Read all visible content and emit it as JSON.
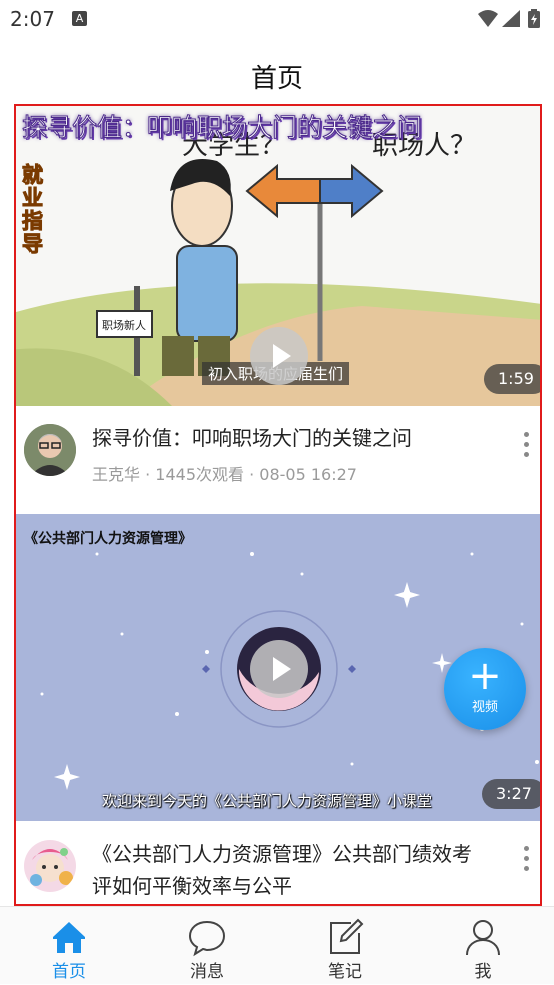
{
  "status_bar": {
    "time": "2:07",
    "notification_icon": "A",
    "icons": [
      "wifi-icon",
      "signal-icon",
      "battery-icon"
    ]
  },
  "header": {
    "title": "首页"
  },
  "videos": [
    {
      "thumbnail_banner": "探寻价值：叩响职场大门的关键之问",
      "thumbnail_side_text": "就业指导",
      "thumbnail_caption": "初入职场的应届生们",
      "thumbnail_bubble_left": "大学生？",
      "thumbnail_bubble_right": "职场人？",
      "thumbnail_sign": "职场新人",
      "duration": "1:59",
      "title": "探寻价值：叩响职场大门的关键之问",
      "author": "王克华",
      "views": "1445次观看",
      "date": "08-05 16:27"
    },
    {
      "thumbnail_topleft": "《公共部门人力资源管理》",
      "thumbnail_caption": "欢迎来到今天的《公共部门人力资源管理》小课堂",
      "duration": "3:27",
      "title": "《公共部门人力资源管理》公共部门绩效考评如何平衡效率与公平"
    }
  ],
  "fab": {
    "label": "视频",
    "icon": "plus-icon"
  },
  "tab_bar": {
    "tabs": [
      {
        "label": "首页",
        "icon": "home-icon",
        "active": true
      },
      {
        "label": "消息",
        "icon": "message-icon",
        "active": false
      },
      {
        "label": "笔记",
        "icon": "note-icon",
        "active": false
      },
      {
        "label": "我",
        "icon": "profile-icon",
        "active": false
      }
    ]
  },
  "colors": {
    "accent": "#1a8fe8",
    "highlight_border": "#e01b1b",
    "meta_gray": "#9a9a9a"
  }
}
